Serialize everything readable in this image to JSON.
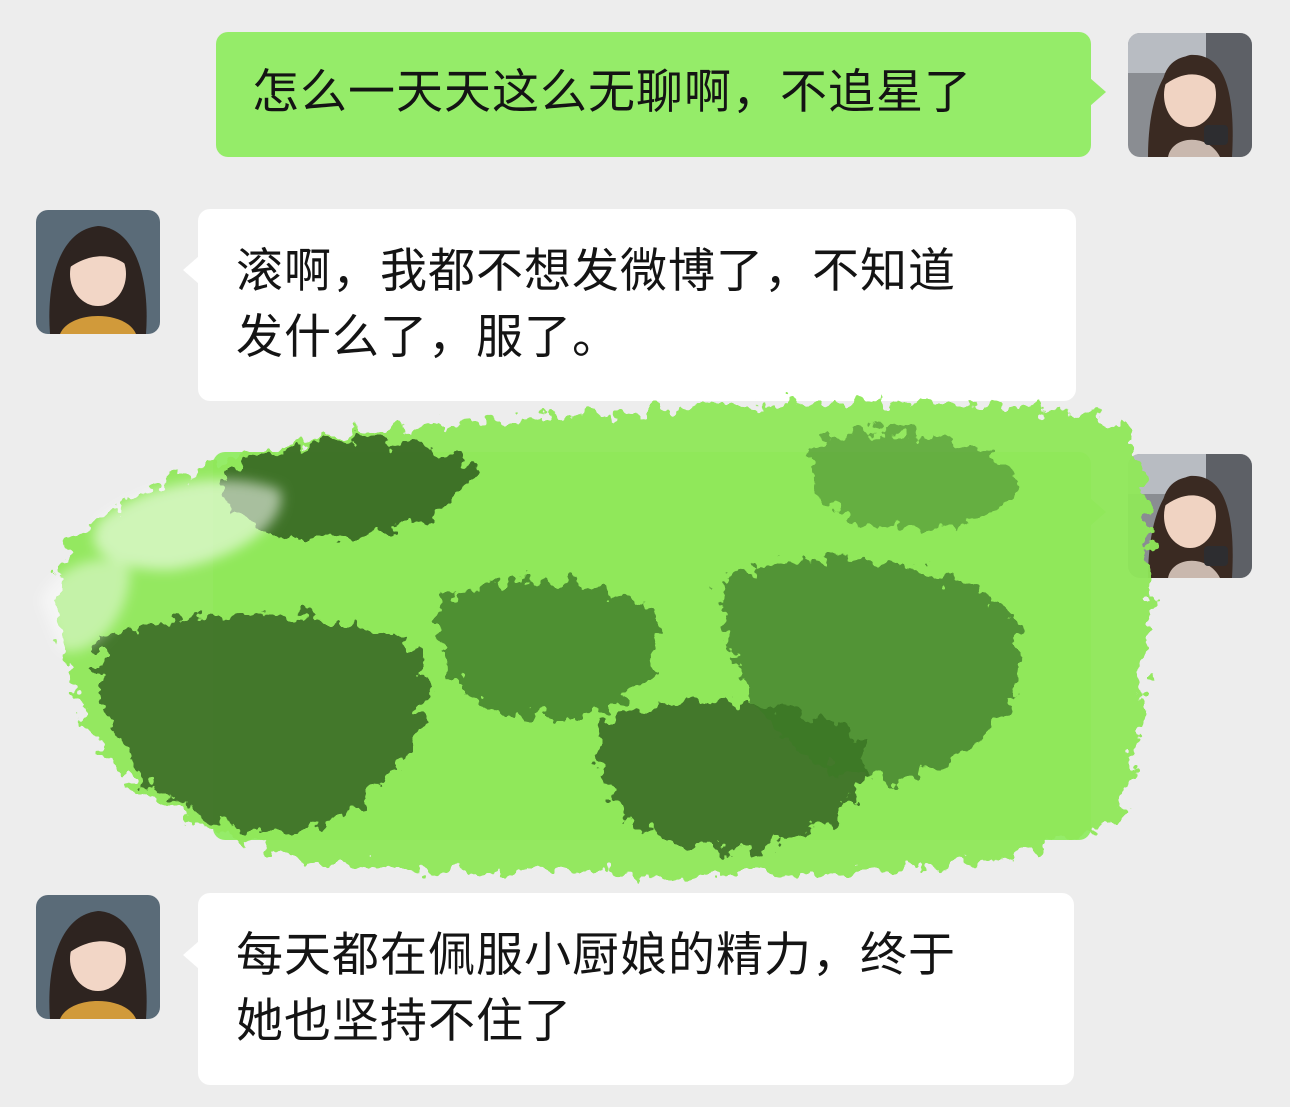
{
  "colors": {
    "background": "#ededed",
    "sent_bubble": "#95ec69",
    "received_bubble": "#ffffff",
    "text": "#141414",
    "scribble_dark": "#2f5e1f",
    "scribble_light": "#8fe85a"
  },
  "messages": [
    {
      "direction": "sent",
      "text": "怎么一天天这么无聊啊，不追星了",
      "avatar": "avatar-self"
    },
    {
      "direction": "received",
      "text": "滚啊，我都不想发微博了，不知道\n发什么了，服了。",
      "avatar": "avatar-friend"
    },
    {
      "direction": "sent",
      "text": "",
      "avatar": "avatar-self",
      "redacted": true
    },
    {
      "direction": "received",
      "text": "每天都在佩服小厨娘的精力，终于\n她也坚持不住了",
      "avatar": "avatar-friend"
    }
  ]
}
